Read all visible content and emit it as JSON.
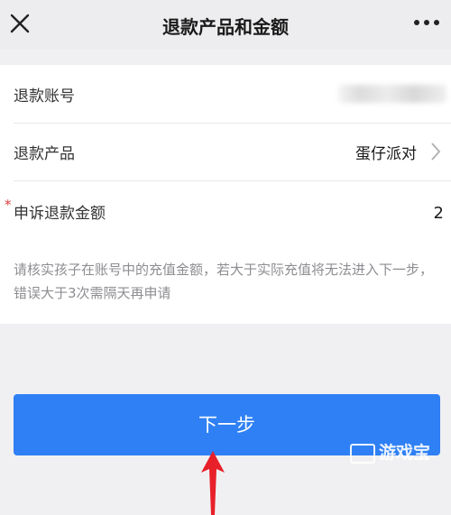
{
  "header": {
    "title": "退款产品和金额",
    "close_icon": "close-icon",
    "more_icon": "more-dots-icon"
  },
  "form": {
    "account_label": "退款账号",
    "product_label": "退款产品",
    "product_value": "蛋仔派对",
    "amount_required_mark": "*",
    "amount_label": "申诉退款金额",
    "amount_value": "2",
    "hint_text": "请核实孩子在账号中的充值金额，若大于实际充值将无法进入下一步，错误大于3次需隔天再申请"
  },
  "actions": {
    "next_label": "下一步"
  },
  "watermark": {
    "text": "游戏宝"
  },
  "colors": {
    "primary": "#2f80f5",
    "annotation_arrow": "#e8202a",
    "required": "#e23d3d"
  }
}
